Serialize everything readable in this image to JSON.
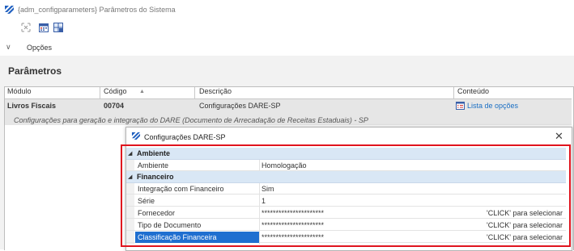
{
  "window": {
    "title": "{adm_configparameters} Parâmetros do Sistema"
  },
  "toolbar": {
    "icons": [
      "expand-icon",
      "calendar-icon",
      "grid-icon"
    ]
  },
  "options": {
    "label": "Opções"
  },
  "panel": {
    "title": "Parâmetros"
  },
  "grid": {
    "columns": [
      "Módulo",
      "Código",
      "Descrição",
      "Conteúdo"
    ],
    "sort_indicator": "▲",
    "rows": [
      {
        "modulo": "Livros Fiscais",
        "codigo": "00704",
        "descricao": "Configurações DARE-SP",
        "conteudo": "Lista de opções",
        "detail": "Configurações para geração e integração do DARE (Documento de Arrecadação de Receitas Estaduais) - SP"
      }
    ]
  },
  "dialog": {
    "title": "Configurações DARE-SP",
    "close": "✕",
    "categories": [
      {
        "label": "Ambiente",
        "items": [
          {
            "name": "Ambiente",
            "value": "Homologação",
            "action": ""
          }
        ]
      },
      {
        "label": "Financeiro",
        "items": [
          {
            "name": "Integração com Financeiro",
            "value": "Sim",
            "action": ""
          },
          {
            "name": "Série",
            "value": "1",
            "action": ""
          },
          {
            "name": "Fornecedor",
            "value": "**********************",
            "action": "'CLICK' para selecionar"
          },
          {
            "name": "Tipo de Documento",
            "value": "**********************",
            "action": "'CLICK' para selecionar"
          },
          {
            "name": "Classificação Financeira",
            "value": "**********************",
            "action": "'CLICK' para selecionar"
          }
        ]
      }
    ],
    "selected_item": "Classificação Financeira",
    "highlight_color": "#e0141e",
    "selection_color": "#1f6fd0"
  }
}
